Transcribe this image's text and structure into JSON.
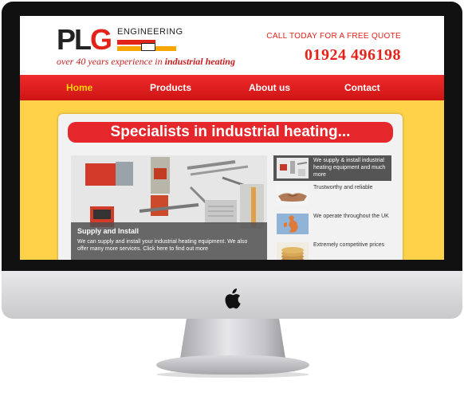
{
  "header": {
    "logo_text": "PLG",
    "logo_subtext": "ENGINEERING",
    "tagline_prefix": "over 40 years experience in",
    "tagline_emphasis": "industrial heating",
    "call_text": "CALL TODAY FOR A FREE QUOTE",
    "phone": "01924 496198"
  },
  "nav": {
    "items": [
      {
        "label": "Home",
        "active": true
      },
      {
        "label": "Products",
        "active": false
      },
      {
        "label": "About us",
        "active": false
      },
      {
        "label": "Contact",
        "active": false
      }
    ]
  },
  "hero": {
    "banner": "Specialists in industrial heating...",
    "slide": {
      "title": "Supply and Install",
      "text": "We can supply and install your industrial heating equipment. We also offer many more services. Click here to find out more"
    },
    "thumbs": [
      {
        "text": "We supply & install industrial heating equipment and much more",
        "icon": "heaters-icon",
        "active": true
      },
      {
        "text": "Trustworthy and reliable",
        "icon": "handshake-icon",
        "active": false
      },
      {
        "text": "We operate throughout the UK",
        "icon": "uk-map-icon",
        "active": false
      },
      {
        "text": "Extremely competitive prices",
        "icon": "coins-icon",
        "active": false
      }
    ]
  },
  "colors": {
    "brand_red": "#e2231a",
    "nav_red": "#d91c1c",
    "background_yellow": "#ffd24a",
    "accent_yellow": "#ffd400"
  },
  "device": {
    "logo_icon": "apple-icon"
  }
}
